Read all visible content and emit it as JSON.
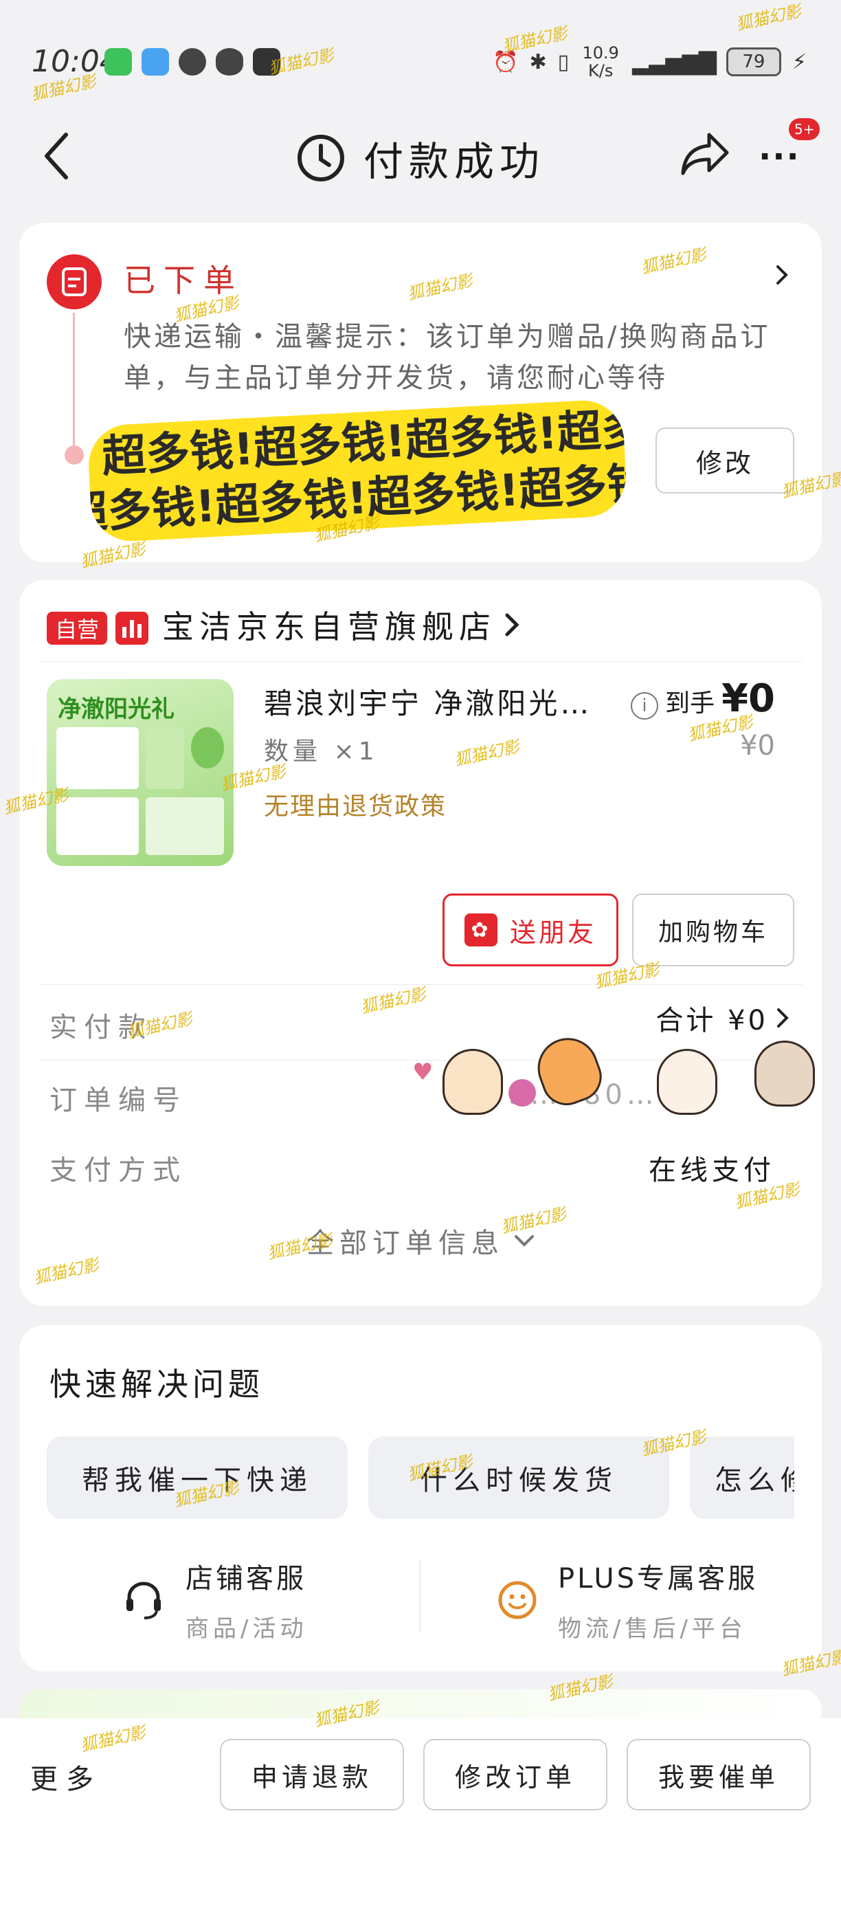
{
  "status_bar": {
    "time": "10:04",
    "net_speed": "10.9 K/s",
    "battery": "79"
  },
  "header": {
    "title": "付款成功",
    "more_badge": "5+"
  },
  "order_status": {
    "title": "已下单",
    "description": "快递运输・温馨提示：该订单为赠品/换购商品订单，与主品订单分开发货，请您耐心等待",
    "sticker_text": "超多钱!超多钱!超多钱!超多钱!超多钱!",
    "modify_label": "修改"
  },
  "shop": {
    "tag": "自营",
    "name": "宝洁京东自营旗舰店"
  },
  "product": {
    "image_title": "净澈阳光礼",
    "name": "碧浪刘宇宁 净澈阳光…",
    "quantity": "数量 ×1",
    "policy": "无理由退货政策",
    "price_label": "到手",
    "price": "¥0",
    "original_price": "¥0"
  },
  "actions": {
    "gift_label": "送朋友",
    "add_cart_label": "加购物车"
  },
  "order_info": {
    "paid_label": "实付款",
    "paid_value": "合计 ¥0",
    "order_no_label": "订单编号",
    "order_no_value": "3…280…",
    "payment_label": "支付方式",
    "payment_value": "在线支付",
    "all_info_label": "全部订单信息"
  },
  "quick_solve": {
    "title": "快速解决问题",
    "pills": [
      "帮我催一下快递",
      "什么时候发货",
      "怎么修"
    ],
    "services": [
      {
        "name": "店铺客服",
        "sub": "商品/活动"
      },
      {
        "name": "PLUS专属客服",
        "sub": "物流/售后/平台"
      }
    ]
  },
  "bottom_bar": {
    "more": "更多",
    "buttons": [
      "申请退款",
      "修改订单",
      "我要催单"
    ]
  },
  "watermark": "狐猫幻影"
}
